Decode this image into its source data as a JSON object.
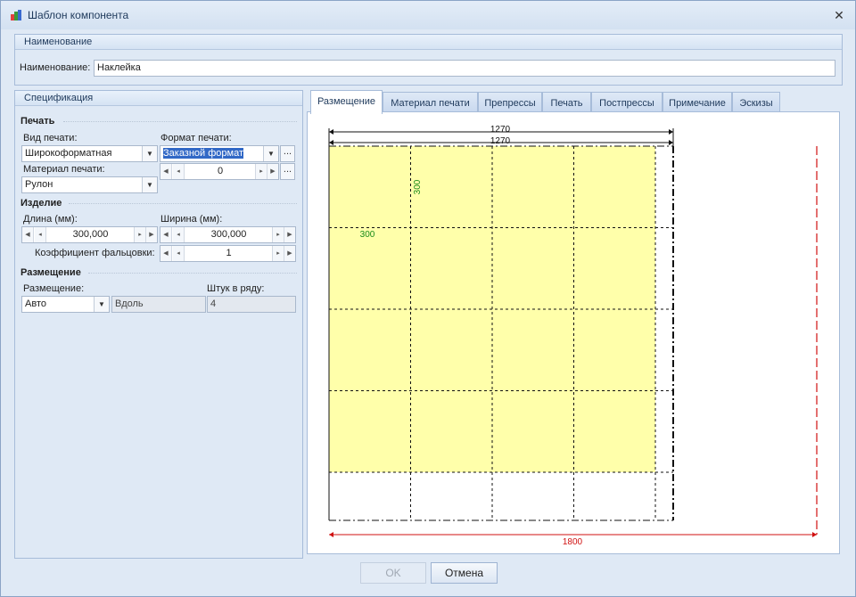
{
  "window": {
    "title": "Шаблон компонента"
  },
  "name_group": {
    "header": "Наименование",
    "label": "Наименование:",
    "value": "Наклейка"
  },
  "spec": {
    "header": "Спецификация",
    "print_section": "Печать",
    "print_type_label": "Вид печати:",
    "print_type_value": "Широкоформатная",
    "print_format_label": "Формат печати:",
    "print_format_value": "Заказной формат",
    "print_material_label": "Материал печати:",
    "print_material_value": "Рулон",
    "format_count_value": "0",
    "product_section": "Изделие",
    "length_label": "Длина (мм):",
    "length_value": "300,000",
    "width_label": "Ширина (мм):",
    "width_value": "300,000",
    "fold_label": "Коэффициент фальцовки:",
    "fold_value": "1",
    "placement_section": "Размещение",
    "placement_label": "Размещение:",
    "placement_value": "Авто",
    "direction_value": "Вдоль",
    "per_row_label": "Штук в ряду:",
    "per_row_value": "4",
    "ellipsis": "..."
  },
  "tabs": [
    "Размещение",
    "Материал печати",
    "Препрессы",
    "Печать",
    "Постпрессы",
    "Примечание",
    "Эскизы"
  ],
  "layout_view": {
    "top_dim_1": "1270",
    "top_dim_2": "1270",
    "item_width": "300",
    "item_height": "300",
    "total_width": "1800",
    "columns": 4,
    "rows": 4,
    "colors": {
      "fill": "#ffffaa",
      "dim_red": "#d01010",
      "dim_green": "#1a8c1a"
    }
  },
  "buttons": {
    "ok": "OK",
    "cancel": "Отмена"
  }
}
